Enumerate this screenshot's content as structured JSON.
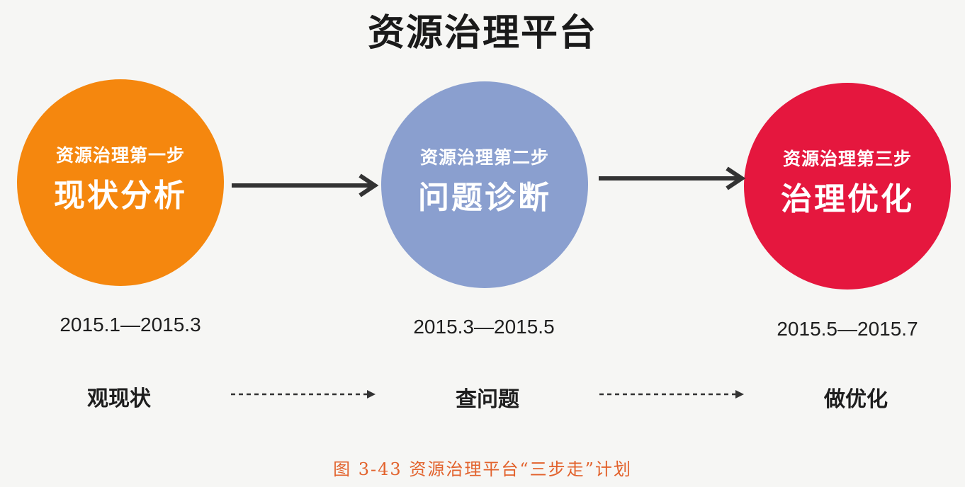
{
  "title": "资源治理平台",
  "colors": {
    "step_1": "#f5870e",
    "step_2": "#8a9fcf",
    "step_3": "#e5173e",
    "arrow": "#333333",
    "caption": "#e2622c"
  },
  "steps": [
    {
      "label": "资源治理第一步",
      "name": "现状分析",
      "period": "2015.1—2015.3",
      "action": "观现状"
    },
    {
      "label": "资源治理第二步",
      "name": "问题诊断",
      "period": "2015.3—2015.5",
      "action": "查问题"
    },
    {
      "label": "资源治理第三步",
      "name": "治理优化",
      "period": "2015.5—2015.7",
      "action": "做优化"
    }
  ],
  "caption": "图 3-43  资源治理平台“三步走”计划"
}
